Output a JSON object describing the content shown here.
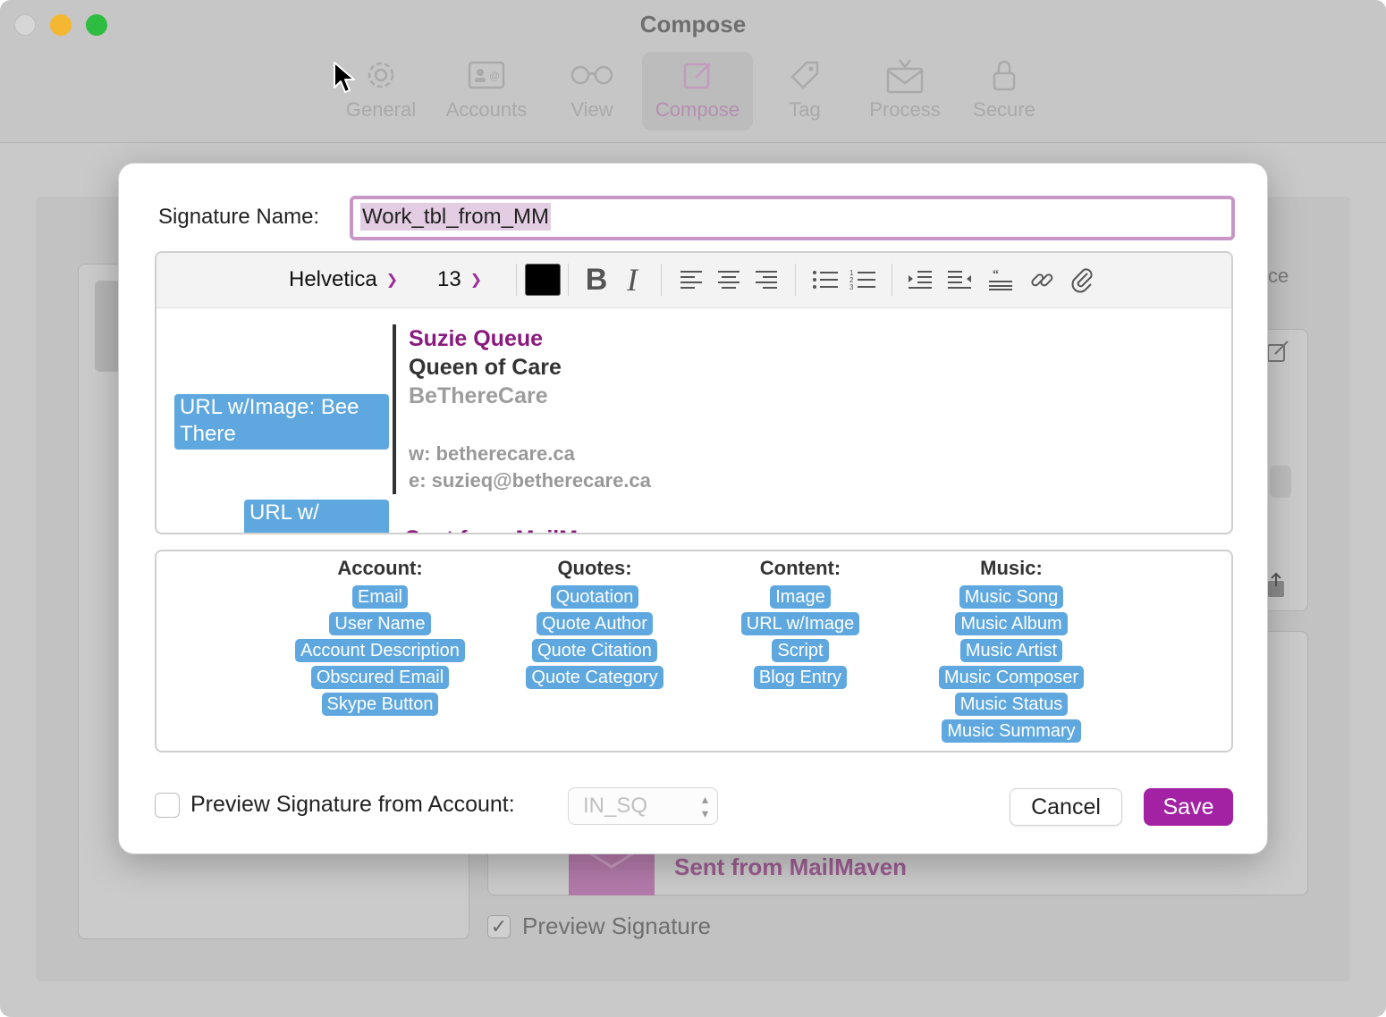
{
  "window": {
    "title": "Compose"
  },
  "toolbar": {
    "items": [
      {
        "label": "General",
        "icon": "gear-icon"
      },
      {
        "label": "Accounts",
        "icon": "contact-card-icon"
      },
      {
        "label": "View",
        "icon": "glasses-icon"
      },
      {
        "label": "Compose",
        "icon": "compose-icon",
        "active": true
      },
      {
        "label": "Tag",
        "icon": "tag-icon"
      },
      {
        "label": "Process",
        "icon": "envelope-process-icon"
      },
      {
        "label": "Secure",
        "icon": "lock-icon"
      }
    ]
  },
  "background": {
    "partial_text": "ce",
    "sent_from": "Sent from MailMaven",
    "preview_signature_label": "Preview Signature",
    "preview_signature_checked": true
  },
  "sheet": {
    "signature_name_label": "Signature Name:",
    "signature_name_value": "Work_tbl_from_MM",
    "editor": {
      "font": "Helvetica",
      "size": "13",
      "text_color": "#000000",
      "tools": [
        "bold-icon",
        "italic-icon",
        "align-left-icon",
        "align-center-icon",
        "align-right-icon",
        "bullet-list-icon",
        "numbered-list-icon",
        "indent-icon",
        "outdent-icon",
        "quote-block-icon",
        "link-icon",
        "attachment-icon"
      ],
      "content": {
        "image_chip": "URL w/Image: Bee There",
        "image_chip_2": "URL w/",
        "name": "Suzie Queue",
        "role": "Queen of Care",
        "company": "BeThereCare",
        "web": "w: betherecare.ca",
        "email": "e: suzieq@betherecare.ca",
        "sent_cut": "Sent from MailM"
      }
    },
    "token_groups": [
      {
        "title": "Account:",
        "tokens": [
          "Email",
          "User Name",
          "Account Description",
          "Obscured Email",
          "Skype Button"
        ]
      },
      {
        "title": "Quotes:",
        "tokens": [
          "Quotation",
          "Quote Author",
          "Quote Citation",
          "Quote Category"
        ]
      },
      {
        "title": "Content:",
        "tokens": [
          "Image",
          "URL w/Image",
          "Script",
          "Blog Entry"
        ]
      },
      {
        "title": "Music:",
        "tokens": [
          "Music Song",
          "Music Album",
          "Music Artist",
          "Music Composer",
          "Music Status",
          "Music Summary"
        ]
      }
    ],
    "footer": {
      "preview_label": "Preview Signature from Account:",
      "preview_checked": false,
      "account_value": "IN_SQ",
      "cancel": "Cancel",
      "save": "Save"
    }
  },
  "colors": {
    "accent": "#a322a4",
    "token_blue": "#5fa8df",
    "signature_purple": "#8a1a7f"
  }
}
